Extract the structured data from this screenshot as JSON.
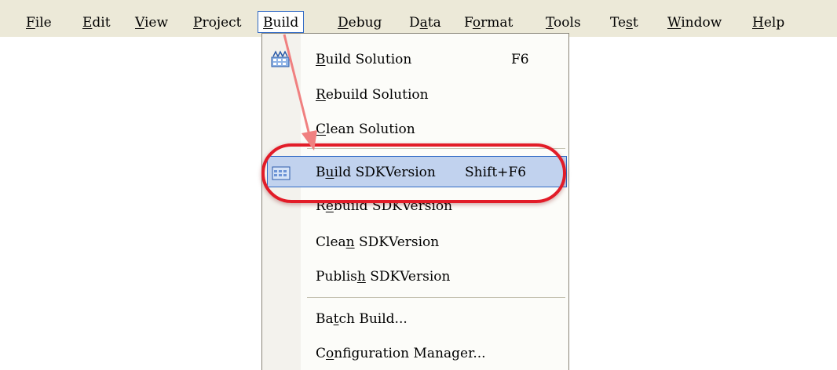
{
  "menubar": {
    "items": [
      {
        "key": "F",
        "rest": "ile"
      },
      {
        "key": "E",
        "rest": "dit"
      },
      {
        "key": "V",
        "rest": "iew"
      },
      {
        "key": "P",
        "rest": "roject"
      },
      {
        "key": "B",
        "rest": "uild"
      },
      {
        "key": "D",
        "rest": "ebug"
      },
      {
        "pre": "D",
        "key": "a",
        "rest": "ta"
      },
      {
        "pre": "F",
        "key": "o",
        "rest": "rmat"
      },
      {
        "key": "T",
        "rest": "ools"
      },
      {
        "pre": "Te",
        "key": "s",
        "rest": "t"
      },
      {
        "key": "W",
        "rest": "indow"
      },
      {
        "key": "H",
        "rest": "elp"
      }
    ]
  },
  "build_menu": {
    "items": [
      {
        "pre": "",
        "key": "B",
        "rest": "uild Solution",
        "shortcut": "F6",
        "icon": "build-solution-icon"
      },
      {
        "pre": "",
        "key": "R",
        "rest": "ebuild Solution",
        "shortcut": "",
        "icon": ""
      },
      {
        "pre": "",
        "key": "C",
        "rest": "lean Solution",
        "shortcut": "",
        "icon": ""
      },
      {
        "pre": "B",
        "key": "u",
        "rest": "ild SDKVersion",
        "shortcut": "Shift+F6",
        "icon": "build-project-icon"
      },
      {
        "pre": "R",
        "key": "e",
        "rest": "build SDKVersion",
        "shortcut": "",
        "icon": ""
      },
      {
        "pre": "Clea",
        "key": "n",
        "rest": " SDKVersion",
        "shortcut": "",
        "icon": ""
      },
      {
        "pre": "Publis",
        "key": "h",
        "rest": " SDKVersion",
        "shortcut": "",
        "icon": ""
      },
      {
        "pre": "Ba",
        "key": "t",
        "rest": "ch Build...",
        "shortcut": "",
        "icon": ""
      },
      {
        "pre": "C",
        "key": "o",
        "rest": "nfiguration Manager...",
        "shortcut": "",
        "icon": ""
      }
    ]
  },
  "annotation": {
    "highlight_color": "#e21c28",
    "arrow_color": "#f08080"
  }
}
